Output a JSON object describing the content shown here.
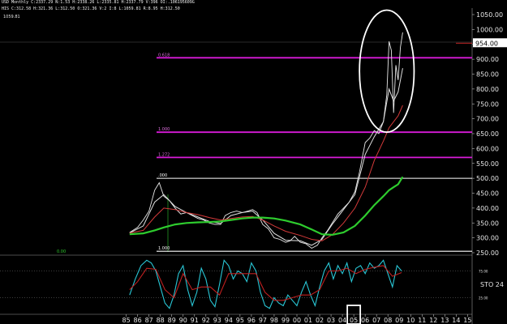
{
  "header": {
    "line1": "USD Monthly  C:2337.29  N:1.53  H:2338.26  L:2335.81  H:2337.79  V:396  OI:.106195609G",
    "line2": "HIS  C:312.58  H:321.36  L:312.50  O:321.36  V:2  I:8  L:1059.81  R:8.95  H:312.50"
  },
  "price_flag": "954.00",
  "top_left_value": "1059.81",
  "chart_data": {
    "type": "line",
    "upper_panel": {
      "ylim": [
        250,
        1050
      ],
      "y_ticks": [
        "1050.00",
        "1000.00",
        "950.00",
        "900.00",
        "850.00",
        "800.00",
        "750.00",
        "700.00",
        "650.00",
        "600.00",
        "550.00",
        "500.00",
        "450.00",
        "400.00",
        "350.00",
        "300.00",
        "250.00"
      ],
      "series": [
        {
          "name": "close",
          "color": "#e8e8e8",
          "x": [
            1985.3,
            1986,
            1986.5,
            1987,
            1987.5,
            1987.9,
            1988.3,
            1988.8,
            1989.3,
            1989.8,
            1990.3,
            1990.8,
            1991.3,
            1991.8,
            1992.3,
            1992.8,
            1993.3,
            1993.7,
            1994.2,
            1994.7,
            1995.2,
            1995.7,
            1996.1,
            1996.5,
            1997,
            1997.5,
            1998,
            1998.5,
            1999,
            1999.4,
            1999.8,
            2000.3,
            2000.8,
            2001.3,
            2001.8,
            2002.2,
            2002.7,
            2003.1,
            2003.6,
            2004.1,
            2004.6,
            2005.1,
            2005.5,
            2006,
            2006.4,
            2006.8,
            2007.2,
            2007.6,
            2007.9,
            2008.1,
            2008.3,
            2008.5,
            2008.7,
            2008.9,
            2009.1,
            2009.3
          ],
          "y": [
            318,
            335,
            360,
            390,
            460,
            485,
            440,
            425,
            400,
            380,
            385,
            375,
            365,
            360,
            350,
            345,
            345,
            375,
            385,
            390,
            385,
            390,
            395,
            385,
            345,
            330,
            300,
            295,
            285,
            290,
            305,
            285,
            280,
            265,
            275,
            300,
            325,
            350,
            380,
            400,
            420,
            455,
            520,
            620,
            635,
            660,
            650,
            690,
            780,
            960,
            930,
            720,
            880,
            830,
            940,
            990
          ]
        },
        {
          "name": "ma_fast",
          "color": "#e0e0e0",
          "x": [
            1985.3,
            1986.5,
            1987.5,
            1988.3,
            1989.3,
            1990.3,
            1991.3,
            1992.3,
            1993.3,
            1994.2,
            1995.2,
            1996.1,
            1997,
            1998,
            1999,
            2000.3,
            2001.3,
            2002.2,
            2003.1,
            2004.1,
            2005.1,
            2006,
            2006.8,
            2007.6,
            2008.1,
            2008.5,
            2008.9,
            2009.3
          ],
          "y": [
            316,
            340,
            420,
            445,
            405,
            385,
            370,
            355,
            348,
            375,
            385,
            390,
            360,
            315,
            292,
            290,
            275,
            295,
            345,
            395,
            445,
            580,
            640,
            690,
            800,
            760,
            790,
            870
          ]
        },
        {
          "name": "ma_mid",
          "color": "#d43a3a",
          "x": [
            1985.3,
            1986.5,
            1987.5,
            1988.3,
            1989.3,
            1990.3,
            1991.3,
            1992.3,
            1993.3,
            1994.2,
            1995.2,
            1996.1,
            1997,
            1998,
            1999,
            2000.3,
            2001.3,
            2002.2,
            2003.1,
            2004.1,
            2005.1,
            2006,
            2006.8,
            2007.6,
            2008.1,
            2008.5,
            2008.9,
            2009.3
          ],
          "y": [
            316,
            325,
            370,
            400,
            395,
            385,
            378,
            368,
            360,
            365,
            370,
            372,
            360,
            340,
            322,
            308,
            295,
            290,
            310,
            350,
            400,
            470,
            560,
            625,
            670,
            690,
            710,
            745
          ]
        },
        {
          "name": "ma_slow",
          "color": "#2ecc2e",
          "x": [
            1985.3,
            1986.5,
            1987.5,
            1988.3,
            1989.3,
            1990.3,
            1991.3,
            1992.3,
            1993.3,
            1994.2,
            1995.2,
            1996.1,
            1997,
            1998,
            1999,
            2000.3,
            2001.3,
            2002.2,
            2003.1,
            2004.1,
            2005.1,
            2006,
            2006.8,
            2007.6,
            2008.1,
            2008.5,
            2008.9,
            2009.3
          ],
          "y": [
            312,
            315,
            325,
            335,
            345,
            350,
            352,
            353,
            355,
            360,
            365,
            368,
            368,
            365,
            358,
            345,
            328,
            312,
            310,
            318,
            340,
            375,
            410,
            440,
            460,
            470,
            480,
            505
          ]
        }
      ],
      "horizontal_levels": [
        {
          "value": 905,
          "color": "#d81bd8",
          "label": "0.618"
        },
        {
          "value": 655,
          "color": "#d81bd8",
          "label": "1.000"
        },
        {
          "value": 570,
          "color": "#d81bd8",
          "label": "1.272"
        },
        {
          "value": 500,
          "color": "#ffffff",
          "label": ".000"
        },
        {
          "value": 255,
          "color": "#ffffff",
          "label": "1.000"
        }
      ],
      "annotations": [
        {
          "type": "ellipse",
          "color": "#ffffff",
          "x_center": 2007.9,
          "y_center": 860,
          "x_radius": 2.4,
          "y_radius": 205
        }
      ],
      "text_labels": [
        {
          "text": "1059.81"
        },
        {
          "text": "0.00"
        }
      ]
    },
    "lower_panel": {
      "name": "STO",
      "label": "STO  24",
      "ylim": [
        0,
        100
      ],
      "y_ticks": [
        "75.00",
        "25.00"
      ],
      "series": [
        {
          "name": "stoch_k",
          "color": "#29c7d6",
          "x": [
            1985.3,
            1985.8,
            1986.3,
            1986.8,
            1987.2,
            1987.6,
            1988,
            1988.4,
            1988.8,
            1989.2,
            1989.6,
            1990,
            1990.4,
            1990.8,
            1991.2,
            1991.6,
            1992,
            1992.4,
            1992.8,
            1993.2,
            1993.6,
            1994,
            1994.4,
            1994.8,
            1995.2,
            1995.6,
            1996,
            1996.4,
            1996.8,
            1997.2,
            1997.6,
            1998,
            1998.4,
            1998.8,
            1999.2,
            1999.6,
            2000,
            2000.4,
            2000.8,
            2001.2,
            2001.6,
            2002,
            2002.4,
            2002.8,
            2003.2,
            2003.6,
            2004,
            2004.4,
            2004.8,
            2005.2,
            2005.6,
            2006,
            2006.4,
            2006.8,
            2007.2,
            2007.6,
            2008,
            2008.4,
            2008.8,
            2009.2
          ],
          "y": [
            30,
            60,
            85,
            95,
            90,
            75,
            45,
            15,
            5,
            30,
            70,
            85,
            40,
            10,
            35,
            80,
            60,
            20,
            8,
            50,
            95,
            85,
            60,
            75,
            70,
            55,
            90,
            75,
            35,
            10,
            5,
            25,
            15,
            10,
            30,
            20,
            10,
            35,
            55,
            30,
            10,
            45,
            75,
            90,
            60,
            85,
            70,
            90,
            55,
            80,
            85,
            70,
            90,
            80,
            85,
            95,
            70,
            45,
            85,
            75
          ]
        },
        {
          "name": "stoch_d",
          "color": "#c02020",
          "x": [
            1985.3,
            1986,
            1986.8,
            1987.6,
            1988.4,
            1989.2,
            1990,
            1990.8,
            1991.6,
            1992.4,
            1993.2,
            1994,
            1994.8,
            1995.6,
            1996.4,
            1997.2,
            1998,
            1998.8,
            1999.6,
            2000.4,
            2001.2,
            2002,
            2002.8,
            2003.6,
            2004.4,
            2005.2,
            2006,
            2006.8,
            2007.6,
            2008.4,
            2009.2
          ],
          "y": [
            40,
            55,
            80,
            78,
            40,
            25,
            70,
            40,
            45,
            45,
            30,
            70,
            70,
            70,
            70,
            35,
            20,
            20,
            25,
            30,
            30,
            40,
            75,
            75,
            80,
            70,
            78,
            82,
            85,
            65,
            72
          ]
        }
      ],
      "levels": [
        75,
        25
      ]
    },
    "x_axis": {
      "type": "year",
      "labels": [
        "85",
        "86",
        "87",
        "88",
        "89",
        "90",
        "91",
        "92",
        "93",
        "94",
        "95",
        "96",
        "97",
        "98",
        "99",
        "00",
        "01",
        "02",
        "03",
        "04",
        "05",
        "06",
        "07",
        "08",
        "09",
        "10",
        "11",
        "12",
        "13",
        "14",
        "15"
      ],
      "highlighted": "05",
      "xlim": [
        1984.6,
        2015.4
      ]
    }
  }
}
